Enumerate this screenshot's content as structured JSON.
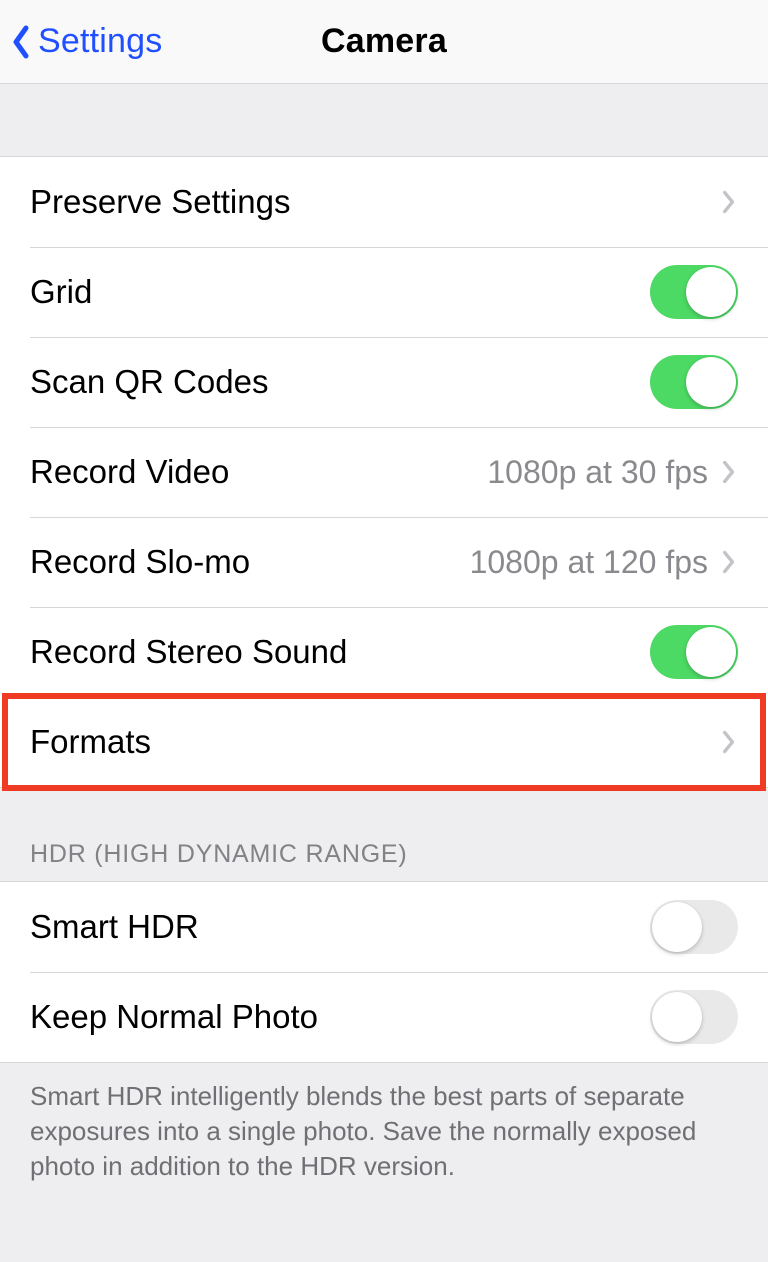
{
  "nav": {
    "back_label": "Settings",
    "title": "Camera"
  },
  "group1": {
    "preserve_settings": "Preserve Settings",
    "grid": "Grid",
    "grid_on": true,
    "scan_qr": "Scan QR Codes",
    "scan_qr_on": true,
    "record_video": "Record Video",
    "record_video_value": "1080p at 30 fps",
    "record_slomo": "Record Slo-mo",
    "record_slomo_value": "1080p at 120 fps",
    "stereo_sound": "Record Stereo Sound",
    "stereo_sound_on": true,
    "formats": "Formats"
  },
  "hdr": {
    "header": "HDR (HIGH DYNAMIC RANGE)",
    "smart_hdr": "Smart HDR",
    "smart_hdr_on": false,
    "keep_normal": "Keep Normal Photo",
    "keep_normal_on": false,
    "footer": "Smart HDR intelligently blends the best parts of separate exposures into a single photo. Save the normally exposed photo in addition to the HDR version."
  }
}
